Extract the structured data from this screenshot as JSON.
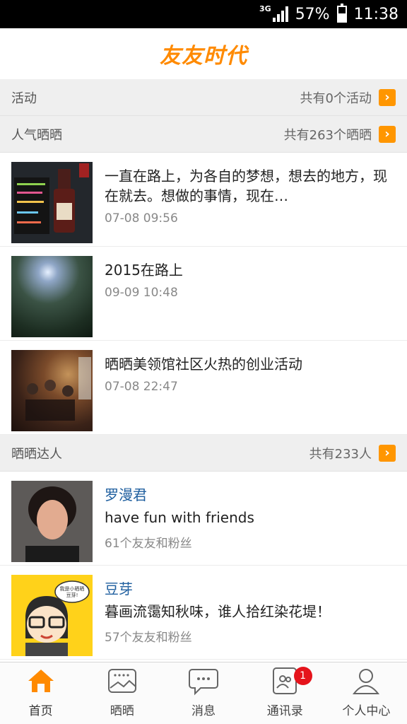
{
  "status_bar": {
    "network": "3G",
    "battery_percent": "57%",
    "battery_level": 0.57,
    "time": "11:38"
  },
  "header": {
    "title": "友友时代"
  },
  "sections": {
    "activity": {
      "title": "活动",
      "count_text": "共有0个活动"
    },
    "popular": {
      "title": "人气晒晒",
      "count_text": "共有263个晒晒"
    },
    "experts": {
      "title": "晒晒达人",
      "count_text": "共有233人"
    }
  },
  "posts": [
    {
      "text": "一直在路上，为各自的梦想，想去的地方，现在就去。想做的事情，现在…",
      "time": "07-08 09:56"
    },
    {
      "text": "2015在路上",
      "time": "09-09 10:48"
    },
    {
      "text": "晒晒美领馆社区火热的创业活动",
      "time": "07-08 22:47"
    }
  ],
  "users": [
    {
      "name": "罗漫君",
      "signature": "have fun with friends",
      "fans": "61个友友和粉丝"
    },
    {
      "name": "豆芽",
      "signature": "暮画流霭知秋味，谁人拾红染花堤！",
      "fans": "57个友友和粉丝",
      "avatar_text": "我是小晒晒 豆芽!"
    }
  ],
  "tabs": [
    {
      "label": "首页",
      "icon": "home-icon",
      "active": true
    },
    {
      "label": "晒晒",
      "icon": "gallery-icon"
    },
    {
      "label": "消息",
      "icon": "message-icon"
    },
    {
      "label": "通讯录",
      "icon": "contacts-icon",
      "badge": "1"
    },
    {
      "label": "个人中心",
      "icon": "user-icon"
    }
  ],
  "colors": {
    "accent": "#ff8a00",
    "link": "#1f5f9f",
    "badge": "#e5131b"
  }
}
